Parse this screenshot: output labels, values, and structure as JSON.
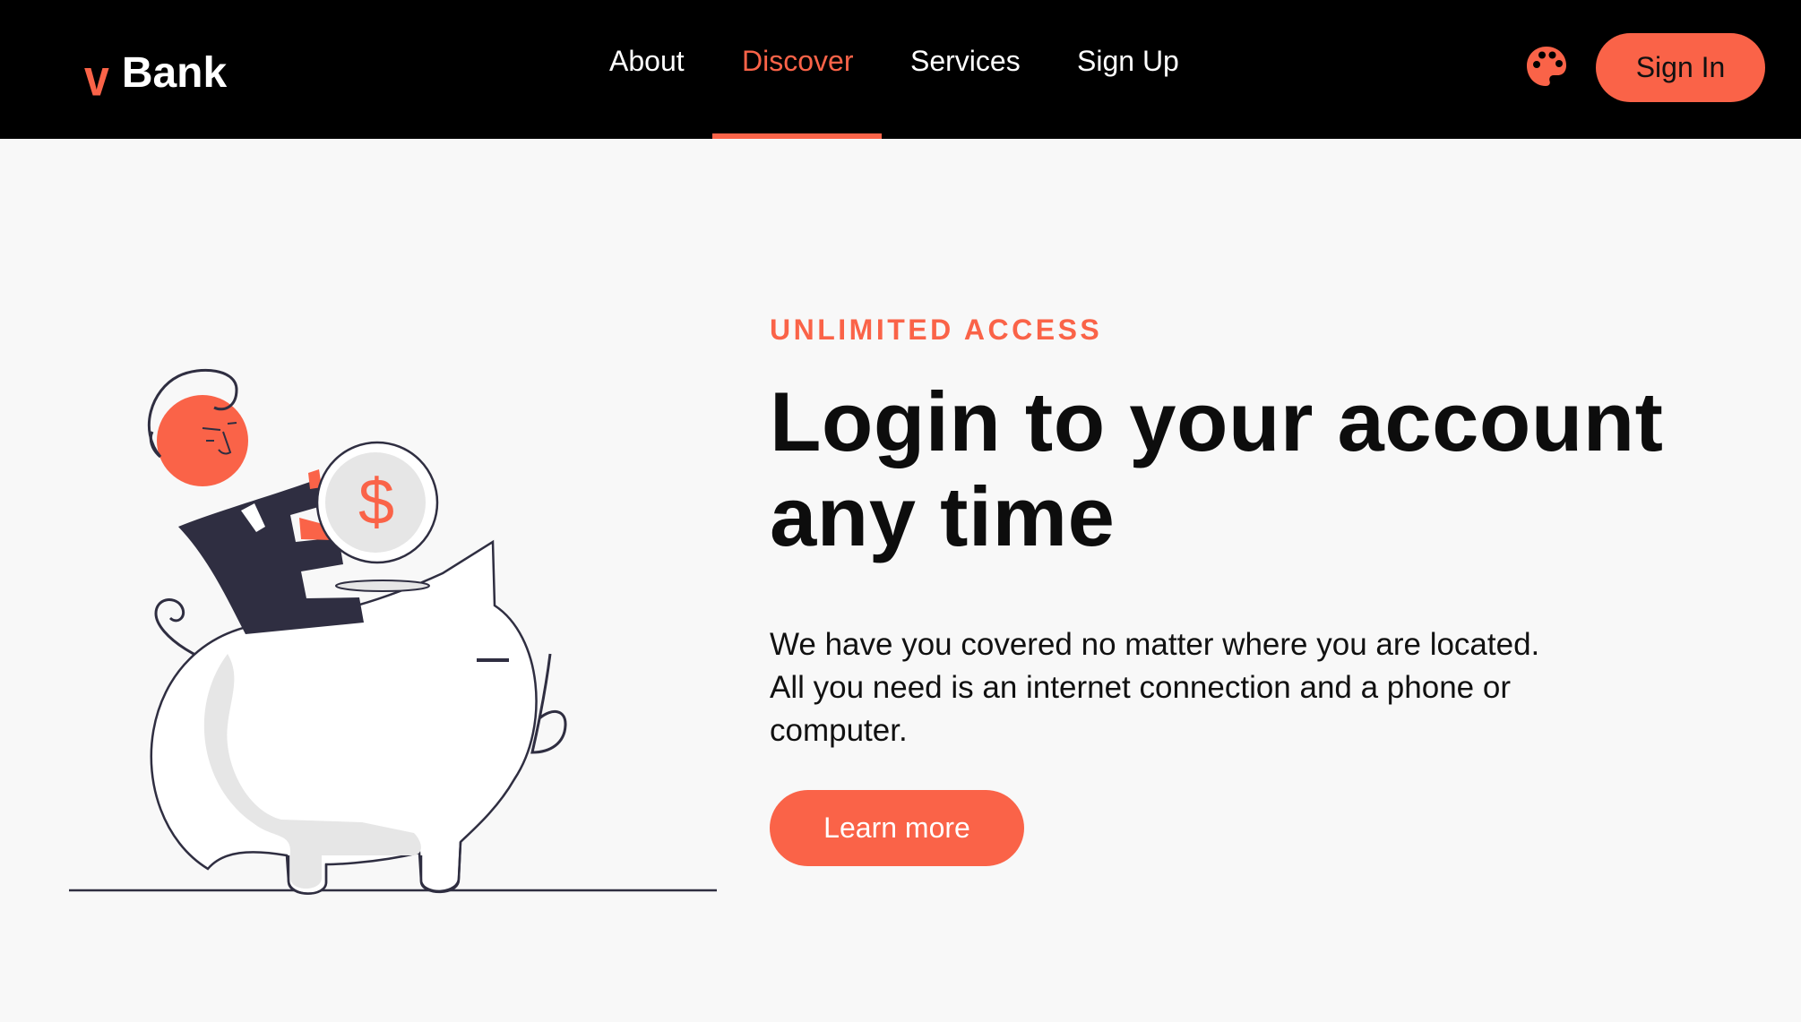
{
  "brand": {
    "mark": "v",
    "name": "Bank"
  },
  "nav": {
    "links": [
      {
        "label": "About",
        "active": false
      },
      {
        "label": "Discover",
        "active": true
      },
      {
        "label": "Services",
        "active": false
      },
      {
        "label": "Sign Up",
        "active": false
      }
    ],
    "theme_icon": "palette-icon",
    "signin_label": "Sign In"
  },
  "hero": {
    "eyebrow": "UNLIMITED ACCESS",
    "title": "Login to your account any time",
    "description": "We have you covered no matter where you are located. All you need is an internet connection and a phone or computer.",
    "cta_label": "Learn more",
    "illustration_icon": "person-with-coin-and-piggy-bank-illustration",
    "coin_symbol": "$"
  },
  "colors": {
    "accent": "#fa6348",
    "nav_background": "#000000",
    "page_background": "#f8f8f8",
    "dark_figure": "#2f2e41"
  }
}
